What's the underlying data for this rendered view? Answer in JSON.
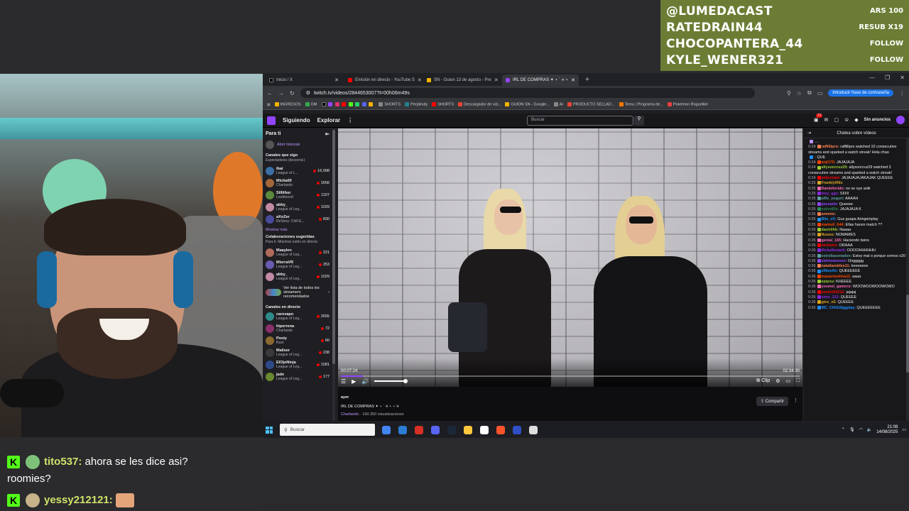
{
  "ticker": {
    "rows": [
      {
        "name": "@LUMEDACAST",
        "tag": "ARS 100"
      },
      {
        "name": "RATEDRAIN44",
        "tag": "RESUB X19"
      },
      {
        "name": "CHOCOPANTERA_44",
        "tag": "FOLLOW"
      },
      {
        "name": "KYLE_WENER321",
        "tag": "FOLLOW"
      }
    ]
  },
  "overlay_chat": {
    "line1_user": "tito537:",
    "line1_msg": "ahora se les dice asi?",
    "line1_cont": "roomies?",
    "line2_user": "yessy212121:",
    "badge": "K"
  },
  "browser": {
    "tabs": [
      {
        "label": "Inicio / X",
        "icon_color": "#000000"
      },
      {
        "label": "Emisión en directo - YouTube S",
        "icon_color": "#ff0000"
      },
      {
        "label": "SN - Guion 13 de agosto - Pre",
        "icon_color": "#f4b400"
      },
      {
        "label": "IRL DE COMPRAS ✦ ⋆ ˙ ⟡ ⋆",
        "icon_color": "#9146ff"
      }
    ],
    "window_controls": [
      "—",
      "❐",
      "✕"
    ],
    "url": "twitch.tv/videos/2844653007?t=00h06m49s",
    "password_button": "Introducir frase de contraseña",
    "bookmarks": [
      {
        "label": "INGRESOS",
        "color": "#f4b400"
      },
      {
        "label": "GM",
        "color": "#34a853"
      },
      {
        "label": "SHORTS",
        "color": "#888888"
      },
      {
        "label": "Perplexity",
        "color": "#20808d"
      },
      {
        "label": "SHORTS",
        "color": "#ff0000"
      },
      {
        "label": "Descargador de vid...",
        "color": "#ea4335"
      },
      {
        "label": "GUION SN - Google...",
        "color": "#f4b400"
      },
      {
        "label": "AI",
        "color": "#888888"
      },
      {
        "label": "PRODUCTO SELLAD...",
        "color": "#ea4335"
      },
      {
        "label": "Temu | Programa de...",
        "color": "#fb7701"
      },
      {
        "label": "Pokemon Roguelike",
        "color": "#e94040"
      }
    ]
  },
  "twitch": {
    "nav_following": "Siguiendo",
    "nav_explore": "Explorar",
    "nav_more": "⋮",
    "search_placeholder": "Buscar",
    "notif_count": "23",
    "no_ads": "Sin anuncios",
    "sidebar": {
      "title": "Para ti",
      "history": "Abrir historial",
      "section_following": "Canales que sigo",
      "section_following_sub": "Espectadores (descend.)",
      "following": [
        {
          "name": "ibai",
          "game": "League of L...",
          "viewers": "16.008",
          "color": "#3a6ea5"
        },
        {
          "name": "Mictia00",
          "game": "Charlando",
          "viewers": "1656",
          "color": "#a5673a"
        },
        {
          "name": "Sillithur",
          "game": "Lootbound",
          "viewers": "1107",
          "color": "#5a8a3c"
        },
        {
          "name": "abby_",
          "game": "League of Leg...",
          "viewers": "1029",
          "color": "#c28aa4"
        },
        {
          "name": "aXoZer",
          "game": "ReStory: Chill E...",
          "viewers": "830",
          "color": "#4a4a9a"
        }
      ],
      "show_more": "Mostrar más",
      "section_collab": "Colaboraciones sugeridas",
      "section_collab_sub": "Para ti. Mientras estés en directo.",
      "collab": [
        {
          "name": "Maaylen",
          "game": "League of Leg...",
          "viewers": "221",
          "color": "#b06a5a"
        },
        {
          "name": "MisrraVR",
          "game": "League of Leg...",
          "viewers": "253",
          "color": "#6a5ab0"
        },
        {
          "name": "abby_",
          "game": "League of Leg...",
          "viewers": "1029",
          "color": "#c28aa4"
        }
      ],
      "see_all": "Ver lista de todos los streamers recomendados",
      "section_live": "Canales en directo",
      "live": [
        {
          "name": "carexapo",
          "game": "League of Leg...",
          "viewers": "2655",
          "color": "#2f8a8a"
        },
        {
          "name": "hiperrena",
          "game": "Charlando",
          "viewers": "72",
          "color": "#8a2f6a"
        },
        {
          "name": "Posty",
          "game": "Rust",
          "viewers": "60",
          "color": "#8a6a2f"
        },
        {
          "name": "Malixer",
          "game": "League of Leg...",
          "viewers": "238",
          "color": "#3a3a3a"
        },
        {
          "name": "ElOjoNinja",
          "game": "League of Leg...",
          "viewers": "1081",
          "color": "#2f4a8a"
        },
        {
          "name": "jade",
          "game": "League of Leg...",
          "viewers": "177",
          "color": "#6a8a2f"
        }
      ]
    },
    "player": {
      "time_current": "00:07:24",
      "time_total": "02:34:30",
      "progress": 0.048,
      "volume": 0.8,
      "clip_label": "Clip"
    },
    "info": {
      "time_ago": "ayer",
      "title": "IRL DE COMPRAS ✦ ⋆ ˙ ⟡ ⋆ ⋆˙⟡",
      "category": "Charlando",
      "views": " · 160.350 visualizaciones",
      "share": "Compartir"
    },
    "chat": {
      "header": "Chatea sobre vídeos",
      "messages": [
        {
          "t": "",
          "u": "",
          "uc": "#bf94ff",
          "m": "..."
        },
        {
          "t": "0:24",
          "u": "raffillipro:",
          "uc": "#ff7f50",
          "m": "raffillipro watched 10 consecutive streams and sparked a watch streak! Hola chao"
        },
        {
          "t": "",
          "u": "",
          "uc": "#1e90ff",
          "m": ": QUE"
        },
        {
          "t": "0:24",
          "u": "anji170:",
          "uc": "#ff4500",
          "m": "JAJAJAJA"
        },
        {
          "t": "0:24",
          "u": "allysoncruz29:",
          "uc": "#9acd32",
          "m": "allysoncruz29 watched 3 consecutive streams and sparked a watch streak!"
        },
        {
          "t": "0:24",
          "u": "milizrivari:",
          "uc": "#ff0000",
          "m": "JAJAJAJAJAKAJAK QUEEEE"
        },
        {
          "t": "0:25",
          "u": "Frankly0fils",
          "uc": "#daa520",
          "m": ""
        },
        {
          "t": "0:25",
          "u": "Danielterido:",
          "uc": "#ff69b4",
          "m": "no se oye ariiii"
        },
        {
          "t": "0:25",
          "u": "mvy_ggz:",
          "uc": "#8a2be2",
          "m": "SIIIIII"
        },
        {
          "t": "0:25",
          "u": "alfie_yogurt:",
          "uc": "#5f9ea0",
          "m": "AAAAH"
        },
        {
          "t": "0:25",
          "u": "pessarki:",
          "uc": "#9146ff",
          "m": "Queeee"
        },
        {
          "t": "0:25",
          "u": "colco60s:",
          "uc": "#2e8b57",
          "m": "JAJAJAJA K"
        },
        {
          "t": "0:25",
          "u": "amimtx:",
          "uc": "#ff7f50",
          "m": ""
        },
        {
          "t": "0:25",
          "u": "Bile_vX:",
          "uc": "#1e90ff",
          "m": "Gus guapa Aringeinplay"
        },
        {
          "t": "0:25",
          "u": "mamu0_644:",
          "uc": "#ff4500",
          "m": "Ellas hacen match ??"
        },
        {
          "t": "0:26",
          "u": "daniriihk:",
          "uc": "#9acd32",
          "m": "Naaaa"
        },
        {
          "t": "0:26",
          "u": "Nuuuu:",
          "uc": "#daa520",
          "m": "NOMAMES"
        },
        {
          "t": "0:26",
          "u": "genial_165:",
          "uc": "#ff69b4",
          "m": "Haciendo twins"
        },
        {
          "t": "0:26",
          "u": "ninilsiriz:",
          "uc": "#ff0000",
          "m": "ORAAA"
        },
        {
          "t": "0:26",
          "u": "Ifinkalkmanfi:",
          "uc": "#8a2be2",
          "m": "OOOOHHHHHH"
        },
        {
          "t": "0:26",
          "u": "estrellasonadsn:",
          "uc": "#5f9ea0",
          "m": "Estoy mal o porque somos s20"
        },
        {
          "t": "0:26",
          "u": "stehnowsvsn:",
          "uc": "#9146ff",
          "m": "Onggggg"
        },
        {
          "t": "0:26",
          "u": "nataliarobles11:",
          "uc": "#ff7f50",
          "m": "keeeeeee"
        },
        {
          "t": "0:26",
          "u": "s0bsofix:",
          "uc": "#1e90ff",
          "m": "QUEEEEEE"
        },
        {
          "t": "0:26",
          "u": "masarmedina11:",
          "uc": "#ff4500",
          "m": "aaaa"
        },
        {
          "t": "0:26",
          "u": "epipsu:",
          "uc": "#9acd32",
          "m": "KHEEEE"
        },
        {
          "t": "0:26",
          "u": "yosmel_gamcro:",
          "uc": "#ff69b4",
          "m": "WOOWOOWOOWOWO"
        },
        {
          "t": "0:26",
          "u": "yenel100212:",
          "uc": "#ff0000",
          "m": "jajajaj"
        },
        {
          "t": "0:26",
          "u": "sime_112:",
          "uc": "#8a2be2",
          "m": "QUEEEE"
        },
        {
          "t": "0:26",
          "u": "gies_v5:",
          "uc": "#daa520",
          "m": "QUEEEE"
        },
        {
          "t": "0:26",
          "u": "MC_Ch01t0ggplay:",
          "uc": "#1e90ff",
          "m": "QUEEEEEEE"
        }
      ]
    }
  },
  "taskbar": {
    "search": "Buscar",
    "time": "21:08",
    "date": "14/08/2025",
    "icon_colors": [
      "#4285f4",
      "#2b7cd3",
      "#d93025",
      "#5865f2",
      "#1b2838",
      "#ffc83d",
      "#ffffff",
      "#fb542b",
      "#2f4fc4",
      "#dddddd"
    ]
  }
}
